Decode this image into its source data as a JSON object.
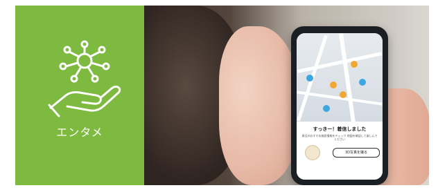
{
  "brand_panel": {
    "label": "エンタメ",
    "background_color": "#7dba3f",
    "icon": "hand-network-icon"
  },
  "phone": {
    "sheet_title": "すっきー！着信しました",
    "sheet_subtitle": "周辺のおすすめ施設情報をチェック 地図を確認して楽しんでください",
    "ar_button_label": "3D写真を撮る"
  }
}
